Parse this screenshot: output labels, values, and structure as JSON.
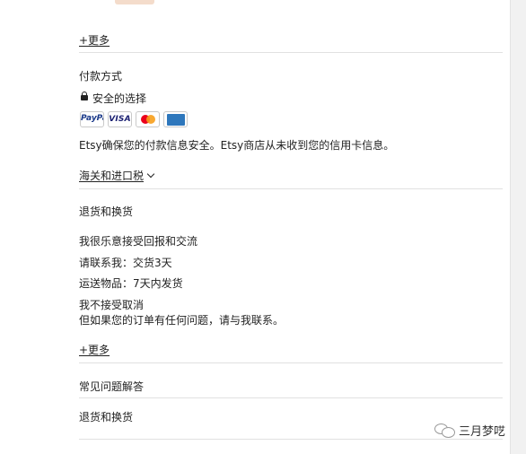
{
  "top_more_link": "+更多",
  "payment": {
    "heading": "付款方式",
    "secure_label": "安全的选择",
    "cards": [
      {
        "icon": "paypal-icon",
        "brand": "PayPal"
      },
      {
        "icon": "visa-icon",
        "brand": "VISA"
      },
      {
        "icon": "mastercard-icon",
        "brand": "Mastercard"
      },
      {
        "icon": "amex-icon",
        "brand": "AMERICAN EXPRESS"
      }
    ],
    "notice": "Etsy确保您的付款信息安全。Etsy商店从未收到您的信用卡信息。"
  },
  "customs_link": "海关和进口税",
  "returns": {
    "heading": "退货和换货",
    "accept_line": "我很乐意接受回报和交流",
    "contact_line": "请联系我：交货3天",
    "ship_line": "运送物品：7天内发货",
    "cancel_line": "我不接受取消",
    "problem_line": "但如果您的订单有任何问题，请与我联系。"
  },
  "bottom_more_link": "+更多",
  "faq": {
    "heading": "常见问题解答",
    "item_returns": "退货和换货"
  },
  "watermark": "三月梦呓",
  "colors": {
    "text": "#222222",
    "divider": "#e1e1e1",
    "paypal_blue": "#1b3a8a",
    "visa_blue": "#1a1f71",
    "mastercard_red": "#eb001b",
    "mastercard_yellow": "#f79e1b",
    "amex_blue": "#2e77bc"
  }
}
